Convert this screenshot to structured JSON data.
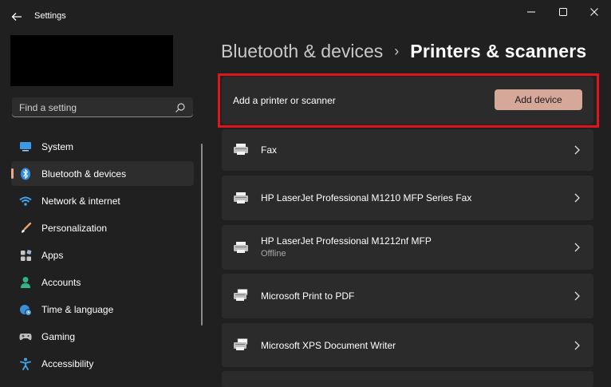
{
  "window": {
    "title": "Settings",
    "controls": [
      "minimize",
      "maximize",
      "close"
    ]
  },
  "search": {
    "placeholder": "Find a setting"
  },
  "sidebar": {
    "items": [
      {
        "label": "System",
        "icon": "monitor-icon",
        "selected": false
      },
      {
        "label": "Bluetooth & devices",
        "icon": "bluetooth-icon",
        "selected": true
      },
      {
        "label": "Network & internet",
        "icon": "wifi-icon",
        "selected": false
      },
      {
        "label": "Personalization",
        "icon": "brush-icon",
        "selected": false
      },
      {
        "label": "Apps",
        "icon": "apps-icon",
        "selected": false
      },
      {
        "label": "Accounts",
        "icon": "person-icon",
        "selected": false
      },
      {
        "label": "Time & language",
        "icon": "globe-clock-icon",
        "selected": false
      },
      {
        "label": "Gaming",
        "icon": "gamepad-icon",
        "selected": false
      },
      {
        "label": "Accessibility",
        "icon": "accessibility-icon",
        "selected": false
      }
    ]
  },
  "breadcrumb": {
    "parent": "Bluetooth & devices",
    "separator": "›",
    "current": "Printers & scanners"
  },
  "add_device": {
    "label": "Add a printer or scanner",
    "button": "Add device"
  },
  "devices": [
    {
      "name": "Fax",
      "status": "",
      "icon": "fax-icon"
    },
    {
      "name": "HP LaserJet Professional M1210 MFP Series Fax",
      "status": "",
      "icon": "printer-icon"
    },
    {
      "name": "HP LaserJet Professional M1212nf MFP",
      "status": "Offline",
      "icon": "printer-icon"
    },
    {
      "name": "Microsoft Print to PDF",
      "status": "",
      "icon": "virtual-printer-icon"
    },
    {
      "name": "Microsoft XPS Document Writer",
      "status": "",
      "icon": "virtual-printer-icon"
    }
  ],
  "colors": {
    "background": "#202020",
    "card": "#2b2b2b",
    "accent": "#d5a89a",
    "highlight": "#e0151b"
  }
}
